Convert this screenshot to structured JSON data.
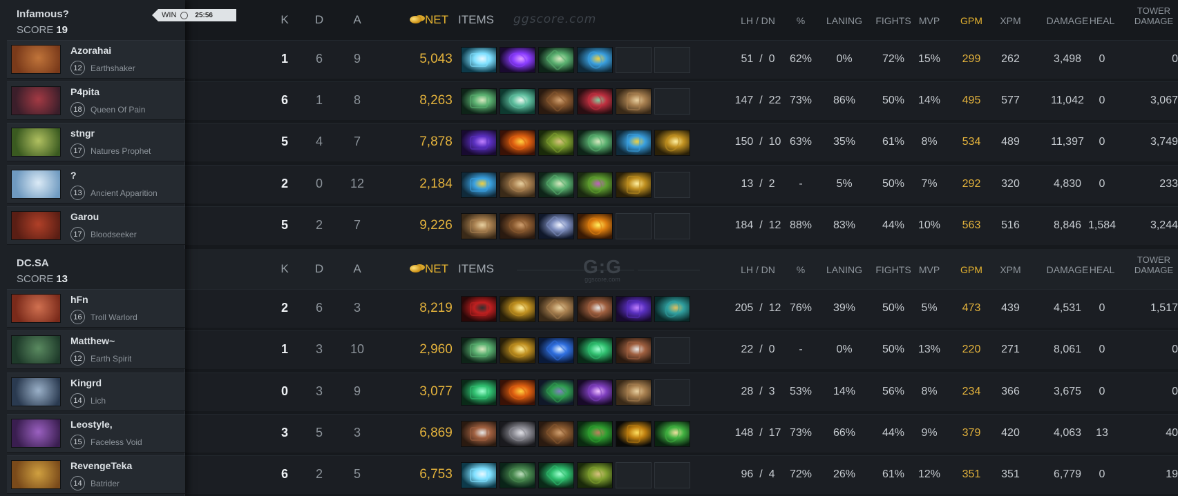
{
  "match": {
    "result": "WIN",
    "duration": "25:56"
  },
  "columns": {
    "k": "K",
    "d": "D",
    "a": "A",
    "net": "NET",
    "items": "ITEMS",
    "lh_dn": "LH / DN",
    "pct": "%",
    "laning": "LANING",
    "fights": "FIGHTS",
    "mvp": "MVP",
    "gpm": "GPM",
    "xpm": "XPM",
    "damage": "DAMAGE",
    "heal": "HEAL",
    "tower_damage": "TOWER DAMAGE"
  },
  "watermark": {
    "top": "ggscore.com",
    "logo": "G:G",
    "logo_sub": "ggscore.com"
  },
  "teams": [
    {
      "name": "Infamous?",
      "score_label": "SCORE",
      "score": "19",
      "players": [
        {
          "name": "Azorahai",
          "level": "12",
          "hero": "Earthshaker",
          "k": "1",
          "d": "6",
          "a": "9",
          "net": "5,043",
          "lh": "51",
          "dn": "0",
          "pct": "62%",
          "laning": "0%",
          "fights": "72%",
          "mvp": "15%",
          "gpm": "299",
          "xpm": "262",
          "damage": "3,498",
          "heal": "0",
          "tower": "0",
          "portrait": [
            "#7a3a1a",
            "#c0743a"
          ],
          "items": [
            "ice-blade",
            "purple-staff",
            "wand",
            "blue-orb",
            "",
            ""
          ]
        },
        {
          "name": "P4pita",
          "level": "18",
          "hero": "Queen Of Pain",
          "k": "6",
          "d": "1",
          "a": "8",
          "net": "8,263",
          "lh": "147",
          "dn": "22",
          "pct": "73%",
          "laning": "86%",
          "fights": "50%",
          "mvp": "14%",
          "gpm": "495",
          "xpm": "577",
          "damage": "11,042",
          "heal": "0",
          "tower": "3,067",
          "portrait": [
            "#3b1e2a",
            "#a33a44"
          ],
          "items": [
            "wand",
            "swirl",
            "boots",
            "rose",
            "scroll",
            ""
          ]
        },
        {
          "name": "stngr",
          "level": "17",
          "hero": "Natures Prophet",
          "k": "5",
          "d": "4",
          "a": "7",
          "net": "7,878",
          "lh": "150",
          "dn": "10",
          "pct": "63%",
          "laning": "35%",
          "fights": "61%",
          "mvp": "8%",
          "gpm": "534",
          "xpm": "489",
          "damage": "11,397",
          "heal": "0",
          "tower": "3,749",
          "portrait": [
            "#3a5a20",
            "#b0c060"
          ],
          "items": [
            "violet-boots",
            "fire-wing",
            "drum",
            "wand",
            "blue-orb",
            "gold-ring"
          ]
        },
        {
          "name": "?",
          "level": "13",
          "hero": "Ancient Apparition",
          "k": "2",
          "d": "0",
          "a": "12",
          "net": "2,184",
          "lh": "13",
          "dn": "2",
          "pct": "-",
          "laning": "5%",
          "fights": "50%",
          "mvp": "7%",
          "gpm": "292",
          "xpm": "320",
          "damage": "4,830",
          "heal": "0",
          "tower": "233",
          "portrait": [
            "#6f9ac0",
            "#dbeaf6"
          ],
          "items": [
            "blue-orb",
            "scroll",
            "wand",
            "green-bag",
            "gold-ring",
            ""
          ]
        },
        {
          "name": "Garou",
          "level": "17",
          "hero": "Bloodseeker",
          "k": "5",
          "d": "2",
          "a": "7",
          "net": "9,226",
          "lh": "184",
          "dn": "12",
          "pct": "88%",
          "laning": "83%",
          "fights": "44%",
          "mvp": "10%",
          "gpm": "563",
          "xpm": "516",
          "damage": "8,846",
          "heal": "1,584",
          "tower": "3,244",
          "portrait": [
            "#5a1e14",
            "#b04028"
          ],
          "items": [
            "scroll",
            "boots",
            "moon",
            "gold-blade",
            "",
            ""
          ]
        }
      ]
    },
    {
      "name": "DC.SA",
      "score_label": "SCORE",
      "score": "13",
      "players": [
        {
          "name": "hFn",
          "level": "16",
          "hero": "Troll Warlord",
          "k": "2",
          "d": "6",
          "a": "3",
          "net": "8,219",
          "lh": "205",
          "dn": "12",
          "pct": "76%",
          "laning": "39%",
          "fights": "50%",
          "mvp": "5%",
          "gpm": "473",
          "xpm": "439",
          "damage": "4,531",
          "heal": "0",
          "tower": "1,517",
          "portrait": [
            "#7a2a1a",
            "#d07050"
          ],
          "items": [
            "red-helm",
            "gold-ring",
            "scroll",
            "axe",
            "violet-boots",
            "teal-ring"
          ]
        },
        {
          "name": "Matthew~",
          "level": "12",
          "hero": "Earth Spirit",
          "k": "1",
          "d": "3",
          "a": "10",
          "net": "2,960",
          "lh": "22",
          "dn": "0",
          "pct": "-",
          "laning": "0%",
          "fights": "50%",
          "mvp": "13%",
          "gpm": "220",
          "xpm": "271",
          "damage": "8,061",
          "heal": "0",
          "tower": "0",
          "portrait": [
            "#1e3a2a",
            "#5a8a60"
          ],
          "items": [
            "wand",
            "gold-ring",
            "potion",
            "green-boots",
            "axe",
            ""
          ]
        },
        {
          "name": "Kingrd",
          "level": "14",
          "hero": "Lich",
          "k": "0",
          "d": "3",
          "a": "9",
          "net": "3,077",
          "lh": "28",
          "dn": "3",
          "pct": "53%",
          "laning": "14%",
          "fights": "56%",
          "mvp": "8%",
          "gpm": "234",
          "xpm": "366",
          "damage": "3,675",
          "heal": "0",
          "tower": "0",
          "portrait": [
            "#2a3a50",
            "#9ab0c8"
          ],
          "items": [
            "green-boots",
            "fire-wing",
            "green-gem",
            "purple-orb",
            "scroll",
            ""
          ]
        },
        {
          "name": "Leostyle,",
          "level": "15",
          "hero": "Faceless Void",
          "k": "3",
          "d": "5",
          "a": "3",
          "net": "6,869",
          "lh": "148",
          "dn": "17",
          "pct": "73%",
          "laning": "66%",
          "fights": "44%",
          "mvp": "9%",
          "gpm": "379",
          "xpm": "420",
          "damage": "4,063",
          "heal": "13",
          "tower": "40",
          "portrait": [
            "#3a1e50",
            "#9a60c0"
          ],
          "items": [
            "axe",
            "grey-orb",
            "boots",
            "green-mask",
            "black-gold",
            "green-blade"
          ]
        },
        {
          "name": "RevengeTeka",
          "level": "14",
          "hero": "Batrider",
          "k": "6",
          "d": "2",
          "a": "5",
          "net": "6,753",
          "lh": "96",
          "dn": "4",
          "pct": "72%",
          "laning": "26%",
          "fights": "61%",
          "mvp": "12%",
          "gpm": "351",
          "xpm": "351",
          "damage": "6,779",
          "heal": "0",
          "tower": "19",
          "portrait": [
            "#7a4a1a",
            "#d0a040"
          ],
          "items": [
            "ice-blade",
            "green-staff",
            "green-boots",
            "drum",
            "",
            ""
          ]
        }
      ]
    }
  ]
}
